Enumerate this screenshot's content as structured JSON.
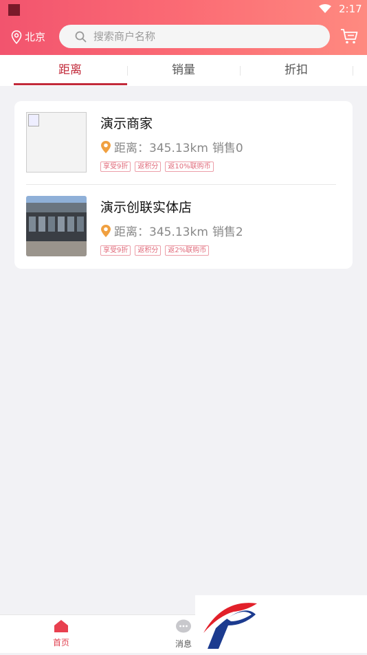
{
  "status_bar": {
    "time": "2:17"
  },
  "header": {
    "city": "北京",
    "search_placeholder": "搜索商户名称"
  },
  "tabs": [
    {
      "label": "距离",
      "active": true
    },
    {
      "label": "销量",
      "active": false
    },
    {
      "label": "折扣",
      "active": false
    }
  ],
  "stores": [
    {
      "name": "演示商家",
      "distance_text": "距离：345.13km",
      "sales_text": "销售0",
      "tags": [
        "享受9折",
        "返积分",
        "返10%联购币"
      ]
    },
    {
      "name": "演示创联实体店",
      "distance_text": "距离：345.13km",
      "sales_text": "销售2",
      "tags": [
        "享受9折",
        "返积分",
        "返2%联购币"
      ]
    }
  ],
  "bottom_nav": {
    "home_label": "首页",
    "messages_label": "消息"
  },
  "colors": {
    "accent": "#c22a3a",
    "header_start": "#f2546e",
    "header_end": "#fe8a80",
    "tag": "#e06a7a",
    "pin": "#f0a040"
  }
}
